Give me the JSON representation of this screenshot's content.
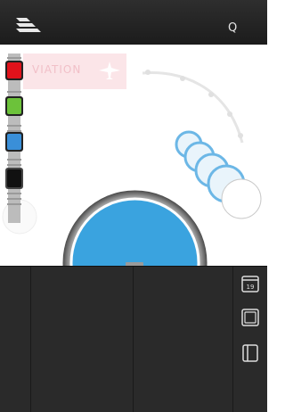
{
  "app": {
    "title": ""
  },
  "topbar": {
    "search_label": "Q"
  },
  "banner": {
    "label": "VIATION"
  },
  "colors": {
    "red": "#e0121b",
    "green": "#6cc23a",
    "blue": "#3a8fd8",
    "black": "#111111",
    "wheel_blue": "#3aa3df",
    "banner_bg": "#fbe5e8",
    "banner_text": "#f1c0c8"
  },
  "swatches": [
    {
      "name": "red-swatch",
      "color": "#e0121b"
    },
    {
      "name": "green-swatch",
      "color": "#6cc23a"
    },
    {
      "name": "blue-swatch",
      "color": "#3a8fd8"
    },
    {
      "name": "black-swatch",
      "color": "#111111"
    }
  ],
  "side_tools": {
    "calendar_label": "19"
  },
  "icons": [
    "menu-icon",
    "search-icon",
    "airplane-icon",
    "calendar-icon",
    "square-icon",
    "panel-icon"
  ]
}
